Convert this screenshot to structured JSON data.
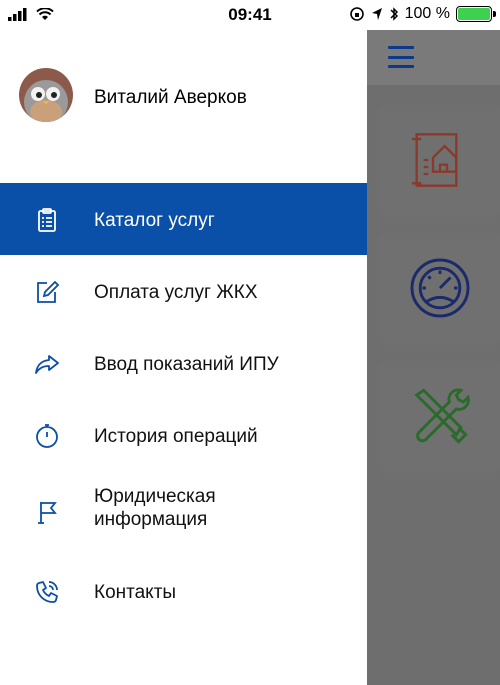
{
  "status": {
    "time": "09:41",
    "battery": "100 %"
  },
  "profile": {
    "name": "Виталий Аверков"
  },
  "menu": {
    "items": [
      {
        "label": "Каталог услуг",
        "icon": "clipboard-icon",
        "active": true
      },
      {
        "label": "Оплата услуг ЖКХ",
        "icon": "edit-icon",
        "active": false
      },
      {
        "label": "Ввод показаний ИПУ",
        "icon": "share-arrow-icon",
        "active": false
      },
      {
        "label": "История операций",
        "icon": "stopwatch-icon",
        "active": false
      },
      {
        "label": "Юридическая информация",
        "icon": "flag-icon",
        "active": false
      },
      {
        "label": "Контакты",
        "icon": "phone-icon",
        "active": false
      }
    ]
  },
  "colors": {
    "accent": "#0a4fa8",
    "icon_blue": "#0a4fa8",
    "tile_red": "#8a3a2a",
    "tile_navy": "#1a2a6a",
    "tile_green": "#2a6a2a",
    "overlay": "#6e6e6e"
  },
  "background_tiles": [
    {
      "icon": "house-document-icon"
    },
    {
      "icon": "gauge-icon"
    },
    {
      "icon": "tools-icon"
    }
  ]
}
